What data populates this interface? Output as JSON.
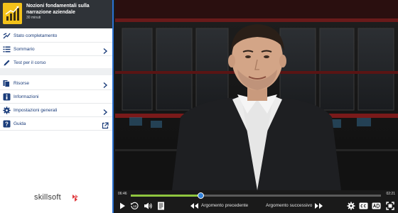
{
  "course": {
    "title": "Nozioni fondamentali sulla narrazione aziendale",
    "duration": "30 minuti"
  },
  "menu_main": [
    {
      "label": "Stato completamento",
      "icon": "completion-status-icon",
      "chevron": false
    },
    {
      "label": "Sommario",
      "icon": "list-icon",
      "chevron": true
    },
    {
      "label": "Test per il corso",
      "icon": "pencil-icon",
      "chevron": false
    }
  ],
  "menu_secondary": [
    {
      "label": "Risorse",
      "icon": "resources-icon",
      "chevron": true
    },
    {
      "label": "Informazioni",
      "icon": "info-icon",
      "chevron": false
    },
    {
      "label": "Impostazioni generali",
      "icon": "gear-icon",
      "chevron": true
    },
    {
      "label": "Guida",
      "icon": "help-icon",
      "chevron": false,
      "external": true
    }
  ],
  "brand": "skillsoft",
  "player": {
    "current_time": "06:46",
    "total_time": "02:21",
    "progress_fraction": 0.28,
    "prev_label": "Argomento precedente",
    "next_label": "Argomento successivo",
    "rewind_seconds": "10"
  },
  "colors": {
    "accent": "#2a72d2",
    "progress": "#8fc63f",
    "header_bg": "#2f3338",
    "brand_red": "#e03a3e"
  }
}
